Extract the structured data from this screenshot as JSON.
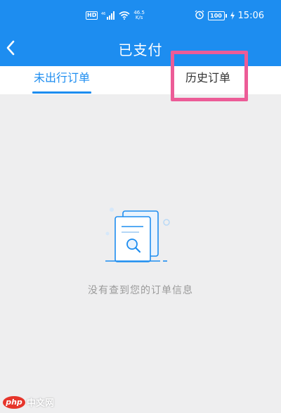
{
  "status_bar": {
    "hd_badge": "HD",
    "signal_label": "46",
    "network_speed": "46.5",
    "network_unit": "K/s",
    "battery": "100",
    "time": "15:06"
  },
  "nav": {
    "title": "已支付",
    "back_icon": "chevron-left-icon"
  },
  "tabs": [
    {
      "label": "未出行订单",
      "active": true
    },
    {
      "label": "历史订单",
      "active": false
    }
  ],
  "empty_state": {
    "icon": "document-search-icon",
    "message": "没有查到您的订单信息"
  },
  "watermark": {
    "logo": "php",
    "site": "中文网"
  },
  "colors": {
    "primary": "#1d8df0",
    "background": "#eeeeef",
    "highlight": "#ec5c97",
    "muted_text": "#9a9a9a"
  }
}
